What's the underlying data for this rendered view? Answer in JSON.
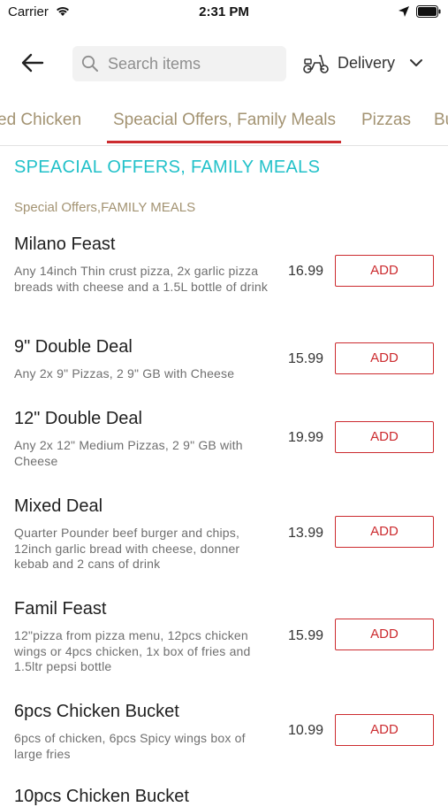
{
  "status_bar": {
    "carrier": "Carrier",
    "time": "2:31 PM"
  },
  "header": {
    "search_placeholder": "Search items",
    "delivery_label": "Delivery"
  },
  "tabs": [
    {
      "label": "ed Chicken"
    },
    {
      "label": "Speacial Offers, Family Meals",
      "active": true
    },
    {
      "label": "Pizzas"
    },
    {
      "label": "Bu"
    }
  ],
  "section": {
    "title": "SPEACIAL OFFERS, FAMILY MEALS",
    "subtitle": "Special Offers,FAMILY MEALS"
  },
  "items": [
    {
      "name": "Milano Feast",
      "description": "Any 14inch Thin crust pizza, 2x garlic pizza breads with cheese and a 1.5L bottle of drink",
      "price": "16.99",
      "action": "ADD"
    },
    {
      "name": "9\" Double Deal",
      "description": "Any 2x 9\" Pizzas, 2  9\" GB with Cheese",
      "price": "15.99",
      "action": "ADD"
    },
    {
      "name": "12\" Double Deal",
      "description": "Any 2x  12\" Medium Pizzas, 2  9\" GB with Cheese",
      "price": "19.99",
      "action": "ADD"
    },
    {
      "name": "Mixed Deal",
      "description": "Quarter Pounder beef burger and chips, 12inch garlic bread with cheese, donner kebab and 2 cans of drink",
      "price": "13.99",
      "action": "ADD"
    },
    {
      "name": "Famil Feast",
      "description": "12\"pizza from pizza menu, 12pcs chicken wings or 4pcs chicken, 1x box of fries and 1.5ltr pepsi bottle",
      "price": "15.99",
      "action": "ADD"
    },
    {
      "name": "6pcs Chicken Bucket",
      "description": "6pcs of chicken, 6pcs Spicy wings box of large fries",
      "price": "10.99",
      "action": "ADD"
    },
    {
      "name": "10pcs Chicken Bucket"
    }
  ],
  "colors": {
    "accent": "#cc2b2f",
    "section_title": "#22c1c9",
    "tab_text": "#a39372"
  }
}
